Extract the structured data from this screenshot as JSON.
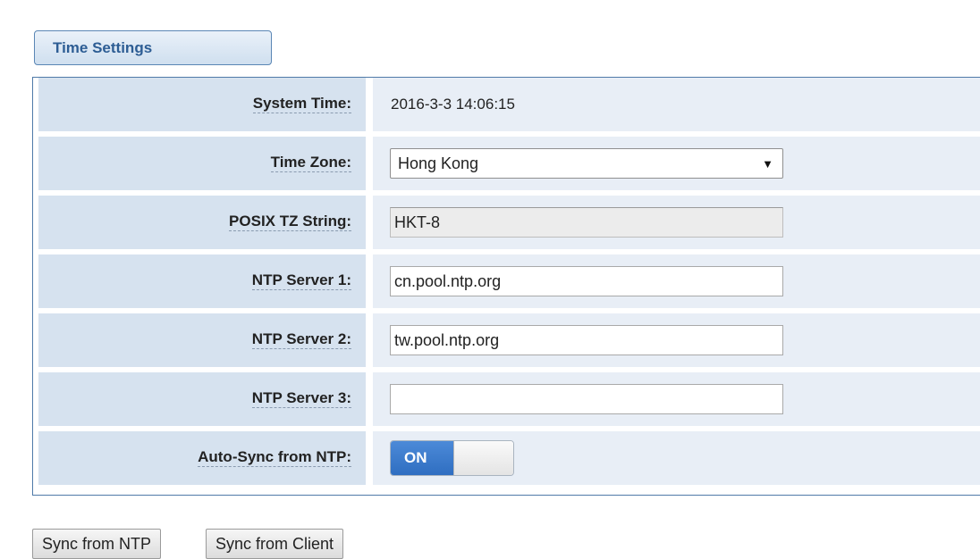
{
  "section": {
    "title": "Time Settings"
  },
  "fields": {
    "system_time": {
      "label": "System Time:",
      "value": "2016-3-3 14:06:15"
    },
    "time_zone": {
      "label": "Time Zone:",
      "selected": "Hong Kong"
    },
    "posix_tz": {
      "label": "POSIX TZ String:",
      "value": "HKT-8"
    },
    "ntp_server_1": {
      "label": "NTP Server 1:",
      "value": "cn.pool.ntp.org"
    },
    "ntp_server_2": {
      "label": "NTP Server 2:",
      "value": "tw.pool.ntp.org"
    },
    "ntp_server_3": {
      "label": "NTP Server 3:",
      "value": ""
    },
    "auto_sync": {
      "label": "Auto-Sync from NTP:",
      "state_label": "ON"
    }
  },
  "buttons": {
    "sync_ntp": "Sync from NTP",
    "sync_client": "Sync from Client"
  },
  "icons": {
    "select_arrow": "chevron-down-icon"
  },
  "colors": {
    "label_bg": "#d6e2ef",
    "value_bg": "#e8eef6",
    "border": "#4f7aa8",
    "toggle_on": "#2f6ec1",
    "tab_text": "#2d5d94"
  }
}
